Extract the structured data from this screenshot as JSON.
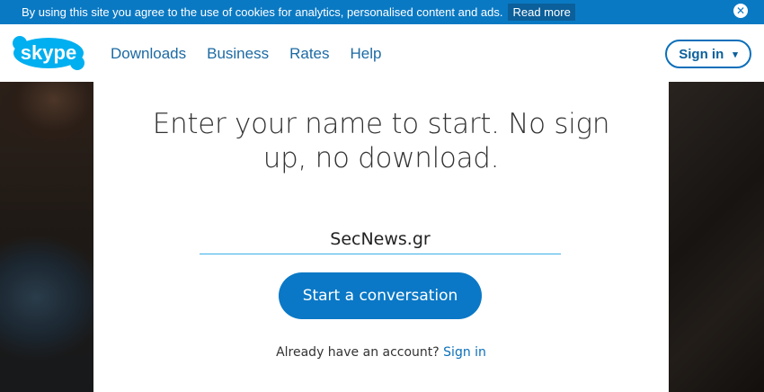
{
  "cookie_banner": {
    "text": "By using this site you agree to the use of cookies for analytics, personalised content and ads.",
    "link": "Read more",
    "close_glyph": "✕"
  },
  "header": {
    "logo_text": "skype",
    "nav": [
      "Downloads",
      "Business",
      "Rates",
      "Help"
    ],
    "signin_label": "Sign in",
    "signin_chevron": "▾",
    "brand_color": "#00aff0"
  },
  "main": {
    "headline": "Enter your name to start. No sign up, no download.",
    "name_value": "SecNews.gr",
    "start_button": "Start a conversation",
    "account_prompt": "Already have an account?",
    "account_link": "Sign in"
  }
}
